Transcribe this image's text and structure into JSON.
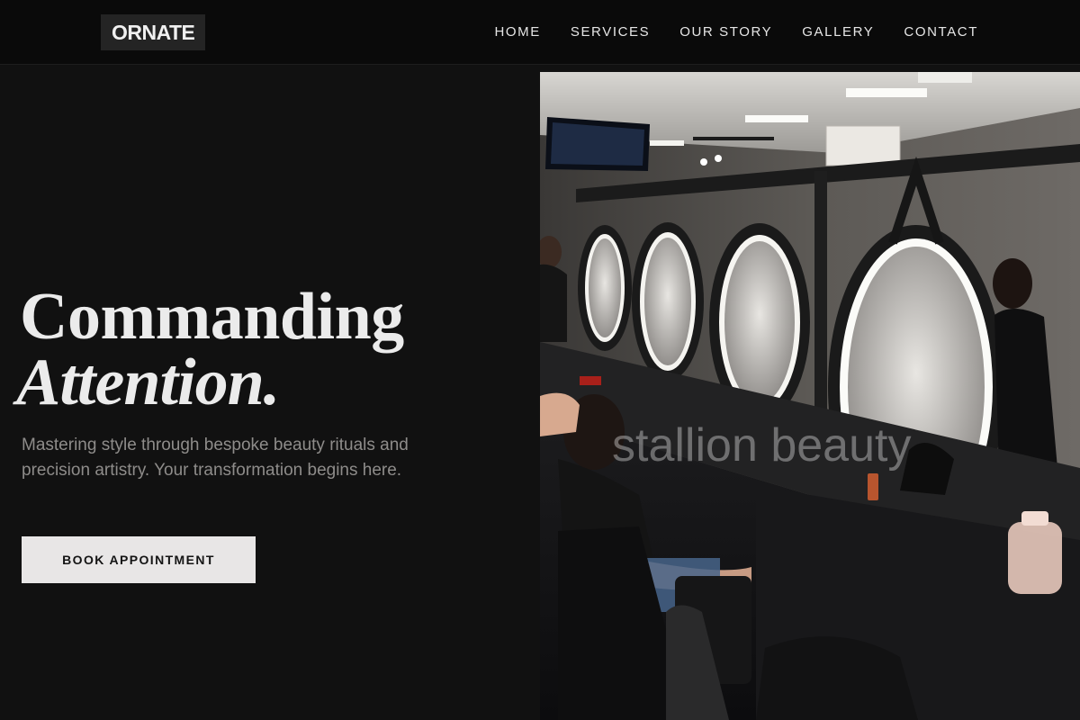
{
  "brand": {
    "logo": "ORNATE"
  },
  "nav": {
    "items": [
      {
        "label": "HOME"
      },
      {
        "label": "SERVICES"
      },
      {
        "label": "OUR STORY"
      },
      {
        "label": "GALLERY"
      },
      {
        "label": "CONTACT"
      }
    ]
  },
  "hero": {
    "title_line1": "Commanding",
    "title_line2": "Attention.",
    "subtitle": "Mastering style through bespoke beauty rituals and precision artistry. Your transformation begins here.",
    "cta_label": "BOOK APPOINTMENT"
  },
  "photo": {
    "watermark": "stallion beauty",
    "subject": "salon interior with round illuminated mirrors and styling chairs"
  },
  "colors": {
    "page_bg": "#111111",
    "header_bg": "#0a0a0a",
    "logo_bg": "#242424",
    "button_bg": "#e8e6e6",
    "muted_text": "#8e8c8a"
  }
}
